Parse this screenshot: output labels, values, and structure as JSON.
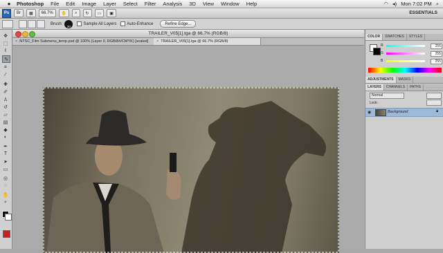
{
  "menubar": {
    "app_name": "Photoshop",
    "items": [
      "File",
      "Edit",
      "Image",
      "Layer",
      "Select",
      "Filter",
      "Analysis",
      "3D",
      "View",
      "Window",
      "Help"
    ],
    "clock": "Mon 7:02 PM"
  },
  "appbar": {
    "logo": "Ps",
    "zoom": "66.7%",
    "workspace": "ESSENTIALS"
  },
  "options": {
    "brush_label": "Brush:",
    "brush_size": "30",
    "sample_all_layers": "Sample All Layers",
    "auto_enhance": "Auto-Enhance",
    "refine_edge": "Refine Edge..."
  },
  "document": {
    "title": "TRAILER_V05[1].tga @ 66.7% (RGB/8)",
    "tabs": [
      {
        "label": "NTSC_Film Submenu_temp.psd @ 100% (Layer 0, RGB/8#/CMYK) [scaled]"
      },
      {
        "label": "TRAILER_V05[1].tga @ 66.7% (RGB/8)"
      }
    ]
  },
  "panels": {
    "color_tabs": [
      "COLOR",
      "SWATCHES",
      "STYLES"
    ],
    "color_values": {
      "r_label": "R",
      "g_label": "G",
      "b_label": "B",
      "r": "255",
      "g": "255",
      "b": "255"
    },
    "adjust_tabs": [
      "ADJUSTMENTS",
      "MASKS"
    ],
    "layers_tabs": [
      "LAYERS",
      "CHANNELS",
      "PATHS"
    ],
    "blend_mode": "Normal",
    "lock_label": "Lock:",
    "layer_name": "Background"
  },
  "colors": {
    "accent": "#9cb9d8",
    "ps_blue": "#2b63b5"
  }
}
